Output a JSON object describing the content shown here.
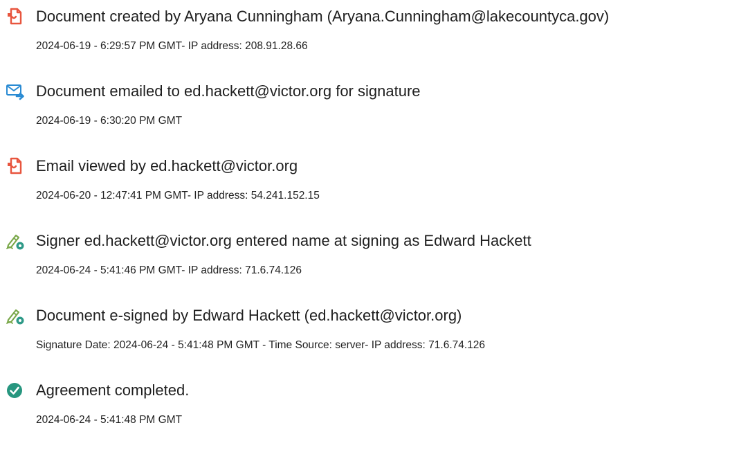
{
  "events": [
    {
      "icon": "document-icon",
      "title": "Document created by Aryana Cunningham (Aryana.Cunningham@lakecountyca.gov)",
      "detail": "2024-06-19 - 6:29:57 PM GMT- IP address: 208.91.28.66"
    },
    {
      "icon": "email-sent-icon",
      "title": "Document emailed to ed.hackett@victor.org for signature",
      "detail": "2024-06-19 - 6:30:20 PM GMT"
    },
    {
      "icon": "document-icon",
      "title": "Email viewed by ed.hackett@victor.org",
      "detail": "2024-06-20 - 12:47:41 PM GMT- IP address: 54.241.152.15"
    },
    {
      "icon": "signature-pen-icon",
      "title": "Signer ed.hackett@victor.org entered name at signing as Edward Hackett",
      "detail": "2024-06-24 - 5:41:46 PM GMT- IP address: 71.6.74.126"
    },
    {
      "icon": "signature-pen-icon",
      "title": "Document e-signed by Edward Hackett (ed.hackett@victor.org)",
      "detail": "Signature Date: 2024-06-24 - 5:41:48 PM GMT - Time Source: server- IP address: 71.6.74.126"
    },
    {
      "icon": "check-circle-icon",
      "title": "Agreement completed.",
      "detail": "2024-06-24 - 5:41:48 PM GMT"
    }
  ],
  "colors": {
    "document_icon": "#e8553e",
    "email_icon": "#2a8bd3",
    "pen_icon": "#7aa84a",
    "pen_badge": "#2f9a88",
    "check_icon": "#27967f",
    "text": "#1f1f1f"
  }
}
